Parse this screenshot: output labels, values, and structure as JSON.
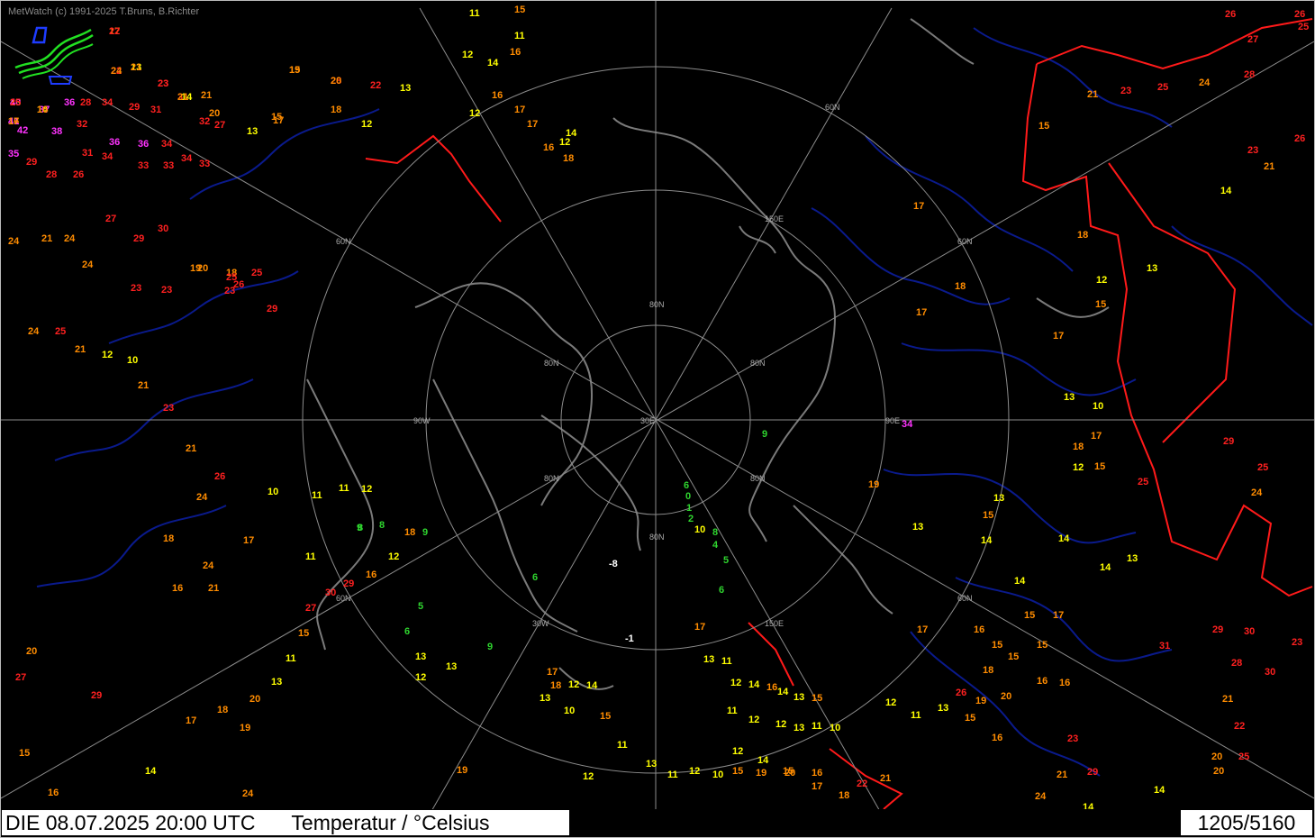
{
  "header": {
    "copyright": "MetWatch  (c) 1991-2025 T.Bruns, B.Richter"
  },
  "footer": {
    "timestamp": "DIE 08.07.2025 20:00 UTC",
    "parameter": "Temperatur / °Celsius",
    "counter": "1205/5160"
  },
  "map": {
    "projection": "polar-stereographic",
    "background": "#000000",
    "grid_color": "#8c8c8c",
    "coast_color": "#7a7a7a",
    "river_color": "#0a1a8c",
    "border_color": "#ff1a1a",
    "latitude_labels": [
      "60N",
      "60N",
      "60N",
      "60N",
      "60N",
      "80N",
      "80N",
      "80N",
      "80N",
      "80N",
      "80N"
    ],
    "longitude_labels": [
      "150E",
      "150E",
      "90W",
      "90E",
      "30W",
      "30E"
    ],
    "temperature_color_scale": [
      {
        "range": "<0",
        "color": "#ffffff"
      },
      {
        "range": "0-9",
        "color": "#2fd52f"
      },
      {
        "range": "10-14",
        "color": "#ffff00"
      },
      {
        "range": "15-22",
        "color": "#ff8c00"
      },
      {
        "range": "23-34",
        "color": "#ff2020"
      },
      {
        "range": ">=35",
        "color": "#ff33ff"
      }
    ]
  },
  "observations": [
    {
      "v": "17",
      "c": "o"
    },
    {
      "v": "13",
      "c": "y"
    },
    {
      "v": "15",
      "c": "o"
    },
    {
      "v": "22",
      "c": "r"
    },
    {
      "v": "28",
      "c": "r"
    },
    {
      "v": "23",
      "c": "r"
    },
    {
      "v": "31",
      "c": "r"
    },
    {
      "v": "13",
      "c": "y"
    },
    {
      "v": "16",
      "c": "o"
    },
    {
      "v": "14",
      "c": "y"
    },
    {
      "v": "21",
      "c": "o"
    },
    {
      "v": "40",
      "c": "m"
    },
    {
      "v": "41",
      "c": "m"
    },
    {
      "v": "37",
      "c": "m"
    },
    {
      "v": "36",
      "c": "m"
    },
    {
      "v": "28",
      "c": "r"
    },
    {
      "v": "34",
      "c": "r"
    },
    {
      "v": "29",
      "c": "r"
    },
    {
      "v": "31",
      "c": "r"
    },
    {
      "v": "20",
      "c": "o"
    },
    {
      "v": "14",
      "c": "y"
    },
    {
      "v": "42",
      "c": "m"
    },
    {
      "v": "38",
      "c": "m"
    },
    {
      "v": "32",
      "c": "r"
    },
    {
      "v": "36",
      "c": "m"
    },
    {
      "v": "36",
      "c": "m"
    },
    {
      "v": "34",
      "c": "r"
    },
    {
      "v": "32",
      "c": "r"
    },
    {
      "v": "27",
      "c": "r"
    },
    {
      "v": "17",
      "c": "o"
    },
    {
      "v": "13",
      "c": "y"
    },
    {
      "v": "15",
      "c": "o"
    },
    {
      "v": "12",
      "c": "y"
    },
    {
      "v": "18",
      "c": "o"
    },
    {
      "v": "22",
      "c": "r"
    },
    {
      "v": "13",
      "c": "y"
    },
    {
      "v": "11",
      "c": "y"
    },
    {
      "v": "15",
      "c": "o"
    },
    {
      "v": "11",
      "c": "y"
    },
    {
      "v": "16",
      "c": "o"
    },
    {
      "v": "12",
      "c": "y"
    },
    {
      "v": "14",
      "c": "y"
    },
    {
      "v": "16",
      "c": "o"
    },
    {
      "v": "12",
      "c": "y"
    },
    {
      "v": "17",
      "c": "o"
    },
    {
      "v": "17",
      "c": "o"
    },
    {
      "v": "18",
      "c": "o"
    },
    {
      "v": "16",
      "c": "o"
    },
    {
      "v": "14",
      "c": "y"
    },
    {
      "v": "12",
      "c": "y"
    },
    {
      "v": "35",
      "c": "m"
    },
    {
      "v": "29",
      "c": "r"
    },
    {
      "v": "28",
      "c": "r"
    },
    {
      "v": "26",
      "c": "r"
    },
    {
      "v": "31",
      "c": "r"
    },
    {
      "v": "34",
      "c": "r"
    },
    {
      "v": "33",
      "c": "r"
    },
    {
      "v": "33",
      "c": "r"
    },
    {
      "v": "34",
      "c": "r"
    },
    {
      "v": "33",
      "c": "r"
    },
    {
      "v": "27",
      "c": "r"
    },
    {
      "v": "29",
      "c": "r"
    },
    {
      "v": "30",
      "c": "r"
    },
    {
      "v": "19",
      "c": "o"
    },
    {
      "v": "18",
      "c": "o"
    },
    {
      "v": "24",
      "c": "o"
    },
    {
      "v": "21",
      "c": "o"
    },
    {
      "v": "24",
      "c": "o"
    },
    {
      "v": "24",
      "c": "o"
    },
    {
      "v": "23",
      "c": "r"
    },
    {
      "v": "25",
      "c": "r"
    },
    {
      "v": "23",
      "c": "r"
    },
    {
      "v": "20",
      "c": "o"
    },
    {
      "v": "23",
      "c": "r"
    },
    {
      "v": "26",
      "c": "r"
    },
    {
      "v": "25",
      "c": "r"
    },
    {
      "v": "29",
      "c": "r"
    },
    {
      "v": "24",
      "c": "o"
    },
    {
      "v": "25",
      "c": "r"
    },
    {
      "v": "21",
      "c": "o"
    },
    {
      "v": "12",
      "c": "y"
    },
    {
      "v": "10",
      "c": "y"
    },
    {
      "v": "21",
      "c": "o"
    },
    {
      "v": "23",
      "c": "r"
    },
    {
      "v": "21",
      "c": "o"
    },
    {
      "v": "26",
      "c": "r"
    },
    {
      "v": "24",
      "c": "o"
    },
    {
      "v": "18",
      "c": "o"
    },
    {
      "v": "16",
      "c": "o"
    },
    {
      "v": "24",
      "c": "o"
    },
    {
      "v": "21",
      "c": "o"
    },
    {
      "v": "17",
      "c": "o"
    },
    {
      "v": "10",
      "c": "y"
    },
    {
      "v": "11",
      "c": "y"
    },
    {
      "v": "11",
      "c": "y"
    },
    {
      "v": "12",
      "c": "y"
    },
    {
      "v": "8",
      "c": "g"
    },
    {
      "v": "9",
      "c": "g"
    },
    {
      "v": "18",
      "c": "o"
    },
    {
      "v": "11",
      "c": "y"
    },
    {
      "v": "8",
      "c": "g"
    },
    {
      "v": "5",
      "c": "g"
    },
    {
      "v": "6",
      "c": "g"
    },
    {
      "v": "13",
      "c": "y"
    },
    {
      "v": "9",
      "c": "g"
    },
    {
      "v": "12",
      "c": "y"
    },
    {
      "v": "13",
      "c": "y"
    },
    {
      "v": "9",
      "c": "g"
    },
    {
      "v": "6",
      "c": "g"
    },
    {
      "v": "-8",
      "c": "w"
    },
    {
      "v": "-1",
      "c": "w"
    },
    {
      "v": "6",
      "c": "g"
    },
    {
      "v": "0",
      "c": "g"
    },
    {
      "v": "1",
      "c": "g"
    },
    {
      "v": "2",
      "c": "g"
    },
    {
      "v": "10",
      "c": "y"
    },
    {
      "v": "8",
      "c": "g"
    },
    {
      "v": "4",
      "c": "g"
    },
    {
      "v": "5",
      "c": "g"
    },
    {
      "v": "6",
      "c": "g"
    },
    {
      "v": "9",
      "c": "g"
    },
    {
      "v": "34",
      "c": "m"
    },
    {
      "v": "19",
      "c": "o"
    },
    {
      "v": "13",
      "c": "y"
    },
    {
      "v": "15",
      "c": "o"
    },
    {
      "v": "14",
      "c": "y"
    },
    {
      "v": "14",
      "c": "y"
    },
    {
      "v": "14",
      "c": "y"
    },
    {
      "v": "15",
      "c": "o"
    },
    {
      "v": "17",
      "c": "o"
    },
    {
      "v": "13",
      "c": "y"
    },
    {
      "v": "14",
      "c": "y"
    },
    {
      "v": "13",
      "c": "y"
    },
    {
      "v": "15",
      "c": "o"
    },
    {
      "v": "15",
      "c": "o"
    },
    {
      "v": "17",
      "c": "o"
    },
    {
      "v": "16",
      "c": "o"
    },
    {
      "v": "15",
      "c": "o"
    },
    {
      "v": "18",
      "c": "o"
    },
    {
      "v": "16",
      "c": "o"
    },
    {
      "v": "16",
      "c": "o"
    },
    {
      "v": "17",
      "c": "o"
    },
    {
      "v": "18",
      "c": "o"
    },
    {
      "v": "15",
      "c": "o"
    },
    {
      "v": "12",
      "c": "y"
    },
    {
      "v": "13",
      "c": "y"
    },
    {
      "v": "10",
      "c": "y"
    },
    {
      "v": "15",
      "c": "o"
    },
    {
      "v": "17",
      "c": "o"
    },
    {
      "v": "17",
      "c": "o"
    },
    {
      "v": "18",
      "c": "o"
    },
    {
      "v": "12",
      "c": "y"
    },
    {
      "v": "13",
      "c": "y"
    },
    {
      "v": "18",
      "c": "o"
    },
    {
      "v": "17",
      "c": "o"
    },
    {
      "v": "15",
      "c": "o"
    },
    {
      "v": "21",
      "c": "o"
    },
    {
      "v": "23",
      "c": "r"
    },
    {
      "v": "25",
      "c": "r"
    },
    {
      "v": "24",
      "c": "o"
    },
    {
      "v": "26",
      "c": "r"
    },
    {
      "v": "27",
      "c": "r"
    },
    {
      "v": "28",
      "c": "r"
    },
    {
      "v": "26",
      "c": "r"
    },
    {
      "v": "23",
      "c": "r"
    },
    {
      "v": "21",
      "c": "o"
    },
    {
      "v": "14",
      "c": "y"
    },
    {
      "v": "25",
      "c": "r"
    },
    {
      "v": "29",
      "c": "r"
    },
    {
      "v": "24",
      "c": "o"
    },
    {
      "v": "25",
      "c": "r"
    },
    {
      "v": "26",
      "c": "r"
    },
    {
      "v": "25",
      "c": "r"
    },
    {
      "v": "31",
      "c": "r"
    },
    {
      "v": "29",
      "c": "r"
    },
    {
      "v": "30",
      "c": "r"
    },
    {
      "v": "28",
      "c": "r"
    },
    {
      "v": "30",
      "c": "r"
    },
    {
      "v": "23",
      "c": "r"
    },
    {
      "v": "21",
      "c": "o"
    },
    {
      "v": "22",
      "c": "r"
    },
    {
      "v": "20",
      "c": "o"
    },
    {
      "v": "20",
      "c": "o"
    },
    {
      "v": "25",
      "c": "r"
    },
    {
      "v": "23",
      "c": "r"
    },
    {
      "v": "21",
      "c": "o"
    },
    {
      "v": "24",
      "c": "o"
    },
    {
      "v": "26",
      "c": "r"
    },
    {
      "v": "19",
      "c": "o"
    },
    {
      "v": "20",
      "c": "o"
    },
    {
      "v": "29",
      "c": "r"
    },
    {
      "v": "14",
      "c": "y"
    },
    {
      "v": "15",
      "c": "o"
    },
    {
      "v": "18",
      "c": "o"
    },
    {
      "v": "14",
      "c": "y"
    },
    {
      "v": "12",
      "c": "y"
    },
    {
      "v": "11",
      "c": "y"
    },
    {
      "v": "13",
      "c": "y"
    },
    {
      "v": "15",
      "c": "o"
    },
    {
      "v": "16",
      "c": "o"
    },
    {
      "v": "15",
      "c": "o"
    },
    {
      "v": "17",
      "c": "o"
    },
    {
      "v": "13",
      "c": "y"
    },
    {
      "v": "11",
      "c": "y"
    },
    {
      "v": "12",
      "c": "y"
    },
    {
      "v": "14",
      "c": "y"
    },
    {
      "v": "16",
      "c": "o"
    },
    {
      "v": "14",
      "c": "y"
    },
    {
      "v": "13",
      "c": "y"
    },
    {
      "v": "15",
      "c": "o"
    },
    {
      "v": "11",
      "c": "y"
    },
    {
      "v": "12",
      "c": "y"
    },
    {
      "v": "12",
      "c": "y"
    },
    {
      "v": "13",
      "c": "y"
    },
    {
      "v": "11",
      "c": "y"
    },
    {
      "v": "10",
      "c": "y"
    },
    {
      "v": "12",
      "c": "y"
    },
    {
      "v": "14",
      "c": "y"
    },
    {
      "v": "15",
      "c": "o"
    },
    {
      "v": "16",
      "c": "o"
    },
    {
      "v": "17",
      "c": "o"
    },
    {
      "v": "18",
      "c": "o"
    },
    {
      "v": "12",
      "c": "y"
    },
    {
      "v": "14",
      "c": "y"
    },
    {
      "v": "15",
      "c": "o"
    },
    {
      "v": "13",
      "c": "y"
    },
    {
      "v": "10",
      "c": "y"
    },
    {
      "v": "11",
      "c": "y"
    },
    {
      "v": "12",
      "c": "y"
    },
    {
      "v": "13",
      "c": "y"
    },
    {
      "v": "11",
      "c": "y"
    },
    {
      "v": "12",
      "c": "y"
    },
    {
      "v": "10",
      "c": "y"
    },
    {
      "v": "15",
      "c": "o"
    },
    {
      "v": "19",
      "c": "o"
    },
    {
      "v": "20",
      "c": "o"
    },
    {
      "v": "17",
      "c": "o"
    },
    {
      "v": "18",
      "c": "o"
    },
    {
      "v": "22",
      "c": "r"
    },
    {
      "v": "21",
      "c": "o"
    },
    {
      "v": "19",
      "c": "o"
    },
    {
      "v": "24",
      "c": "o"
    },
    {
      "v": "20",
      "c": "o"
    },
    {
      "v": "27",
      "c": "r"
    },
    {
      "v": "29",
      "c": "r"
    },
    {
      "v": "15",
      "c": "o"
    },
    {
      "v": "16",
      "c": "o"
    },
    {
      "v": "14",
      "c": "y"
    },
    {
      "v": "17",
      "c": "o"
    },
    {
      "v": "18",
      "c": "o"
    },
    {
      "v": "19",
      "c": "o"
    },
    {
      "v": "20",
      "c": "o"
    },
    {
      "v": "13",
      "c": "y"
    },
    {
      "v": "11",
      "c": "y"
    },
    {
      "v": "15",
      "c": "o"
    },
    {
      "v": "27",
      "c": "r"
    },
    {
      "v": "30",
      "c": "r"
    },
    {
      "v": "29",
      "c": "r"
    },
    {
      "v": "16",
      "c": "o"
    },
    {
      "v": "12",
      "c": "y"
    },
    {
      "v": "22",
      "c": "r"
    },
    {
      "v": "21",
      "c": "o"
    },
    {
      "v": "19",
      "c": "o"
    },
    {
      "v": "24",
      "c": "o"
    },
    {
      "v": "20",
      "c": "o"
    },
    {
      "v": "23",
      "c": "r"
    },
    {
      "v": "21",
      "c": "o"
    },
    {
      "v": "25",
      "c": "r"
    },
    {
      "v": "17",
      "c": "o"
    },
    {
      "v": "16",
      "c": "o"
    }
  ]
}
